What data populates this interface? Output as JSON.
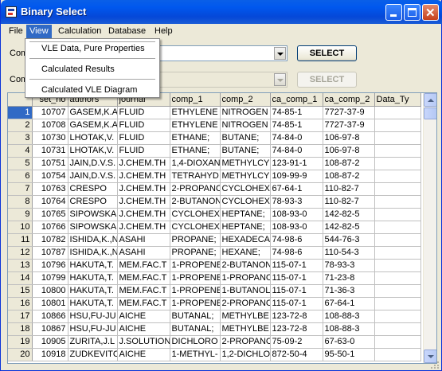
{
  "window": {
    "title": "Binary Select"
  },
  "menu": {
    "items": [
      "File",
      "View",
      "Calculation",
      "Database",
      "Help"
    ],
    "active_index": 1
  },
  "view_menu": {
    "items": [
      "VLE Data, Pure Properties",
      "Calculated Results",
      "Calculated VLE Diagram"
    ]
  },
  "form": {
    "label1": "Com",
    "label2": "Com",
    "combo1_value": "",
    "combo2_value": "",
    "select_button": "SELECT",
    "select_button_2": "SELECT"
  },
  "grid": {
    "columns": [
      "",
      "set_no",
      "authors",
      "journal",
      "comp_1",
      "comp_2",
      "ca_comp_1",
      "ca_comp_2",
      "Data_Ty"
    ],
    "rows": [
      [
        "1",
        "10707",
        "GASEM,K.A",
        "FLUID",
        "ETHYLENE",
        "NITROGEN",
        "74-85-1",
        "7727-37-9",
        ""
      ],
      [
        "2",
        "10708",
        "GASEM,K.A",
        "FLUID",
        "ETHYLENE",
        "NITROGEN",
        "74-85-1",
        "7727-37-9",
        ""
      ],
      [
        "3",
        "10730",
        "LHOTAK,V.",
        "FLUID",
        "ETHANE;",
        "BUTANE;",
        "74-84-0",
        "106-97-8",
        ""
      ],
      [
        "4",
        "10731",
        "LHOTAK,V.",
        "FLUID",
        "ETHANE;",
        "BUTANE;",
        "74-84-0",
        "106-97-8",
        ""
      ],
      [
        "5",
        "10751",
        "JAIN,D.V.S.",
        "J.CHEM.TH",
        "1,4-DIOXAN",
        "METHYLCY",
        "123-91-1",
        "108-87-2",
        ""
      ],
      [
        "6",
        "10754",
        "JAIN,D.V.S.",
        "J.CHEM.TH",
        "TETRAHYD",
        "METHYLCY",
        "109-99-9",
        "108-87-2",
        ""
      ],
      [
        "7",
        "10763",
        "CRESPO",
        "J.CHEM.TH",
        "2-PROPANC",
        "CYCLOHEX",
        "67-64-1",
        "110-82-7",
        ""
      ],
      [
        "8",
        "10764",
        "CRESPO",
        "J.CHEM.TH",
        "2-BUTANON",
        "CYCLOHEX",
        "78-93-3",
        "110-82-7",
        ""
      ],
      [
        "9",
        "10765",
        "SIPOWSKA",
        "J.CHEM.TH",
        "CYCLOHEX",
        "HEPTANE;",
        "108-93-0",
        "142-82-5",
        ""
      ],
      [
        "10",
        "10766",
        "SIPOWSKA",
        "J.CHEM.TH",
        "CYCLOHEX",
        "HEPTANE;",
        "108-93-0",
        "142-82-5",
        ""
      ],
      [
        "11",
        "10782",
        "ISHIDA,K.,N",
        "ASAHI",
        "PROPANE;",
        "HEXADECA",
        "74-98-6",
        "544-76-3",
        ""
      ],
      [
        "12",
        "10787",
        "ISHIDA,K.,N",
        "ASAHI",
        "PROPANE;",
        "HEXANE;",
        "74-98-6",
        "110-54-3",
        ""
      ],
      [
        "13",
        "10796",
        "HAKUTA,T.",
        "MEM.FAC.T",
        "1-PROPENE",
        "2-BUTANON",
        "115-07-1",
        "78-93-3",
        ""
      ],
      [
        "14",
        "10799",
        "HAKUTA,T.",
        "MEM.FAC.T",
        "1-PROPENE",
        "1-PROPANC",
        "115-07-1",
        "71-23-8",
        ""
      ],
      [
        "15",
        "10800",
        "HAKUTA,T.",
        "MEM.FAC.T",
        "1-PROPENE",
        "1-BUTANOL",
        "115-07-1",
        "71-36-3",
        ""
      ],
      [
        "16",
        "10801",
        "HAKUTA,T.",
        "MEM.FAC.T",
        "1-PROPENE",
        "2-PROPANC",
        "115-07-1",
        "67-64-1",
        ""
      ],
      [
        "17",
        "10866",
        "HSU,FU-JU",
        "AICHE",
        "BUTANAL;",
        "METHYLBE",
        "123-72-8",
        "108-88-3",
        ""
      ],
      [
        "18",
        "10867",
        "HSU,FU-JU",
        "AICHE",
        "BUTANAL;",
        "METHYLBE",
        "123-72-8",
        "108-88-3",
        ""
      ],
      [
        "19",
        "10905",
        "ZURITA,J.L",
        "J.SOLUTION",
        "DICHLORO",
        "2-PROPANC",
        "75-09-2",
        "67-63-0",
        ""
      ],
      [
        "20",
        "10918",
        "ZUDKEVITC",
        "AICHE",
        "1-METHYL-",
        "1,2-DICHLO",
        "872-50-4",
        "95-50-1",
        ""
      ]
    ],
    "selected_row": 0
  }
}
